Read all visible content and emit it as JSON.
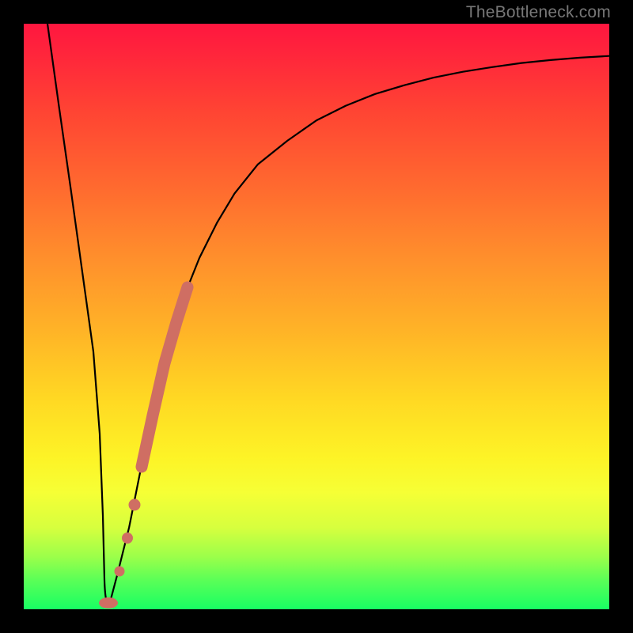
{
  "watermark": "TheBottleneck.com",
  "colors": {
    "frame": "#000000",
    "gradient_top": "#ff163f",
    "gradient_bottom": "#18ff63",
    "curve": "#000000",
    "salmon": "#cf6e63"
  },
  "chart_data": {
    "type": "line",
    "title": "",
    "xlabel": "",
    "ylabel": "",
    "xlim": [
      0,
      100
    ],
    "ylim": [
      0,
      100
    ],
    "series": [
      {
        "name": "bottleneck-curve",
        "x": [
          0,
          2,
          4,
          6,
          8,
          10,
          12,
          13,
          14,
          16,
          18,
          20,
          22,
          24,
          26,
          28,
          30,
          33,
          36,
          40,
          45,
          50,
          55,
          60,
          65,
          70,
          75,
          80,
          85,
          90,
          95,
          100
        ],
        "y": [
          100,
          86,
          72,
          58,
          44,
          30,
          16,
          5,
          2,
          6,
          14,
          24,
          33,
          42,
          49,
          55,
          60,
          66,
          71,
          76,
          80,
          83.5,
          86,
          88,
          89.5,
          90.8,
          91.8,
          92.6,
          93.3,
          93.8,
          94.2,
          94.5
        ]
      }
    ],
    "annotations": [
      {
        "name": "salmon-segment",
        "x_range": [
          20,
          28
        ],
        "note": "thick salmon overlay on rising branch"
      },
      {
        "name": "salmon-dot-upper",
        "x": 18.5
      },
      {
        "name": "salmon-dot-lower",
        "x": 16.5
      },
      {
        "name": "salmon-dot-bottom",
        "x": 13.5
      }
    ]
  }
}
